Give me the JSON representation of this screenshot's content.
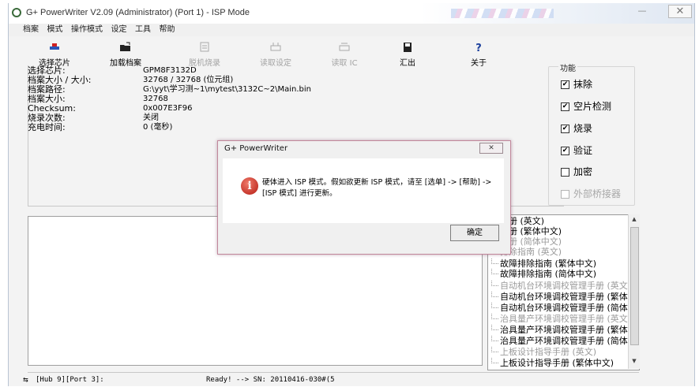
{
  "window": {
    "title": "G+ PowerWriter V2.09 (Administrator) (Port 1) - ISP Mode",
    "close_label": "✕",
    "minimize_label": "—"
  },
  "menubar": {
    "items": [
      "档案",
      "模式",
      "操作模式",
      "设定",
      "工具",
      "帮助"
    ]
  },
  "toolbar": {
    "buttons": [
      {
        "label": "选择芯片",
        "icon": "chip-select-icon",
        "enabled": true
      },
      {
        "label": "加载档案",
        "icon": "folder-open-icon",
        "enabled": true
      },
      {
        "label": "脱机烧录",
        "icon": "offline-burn-icon",
        "enabled": false
      },
      {
        "label": "读取设定",
        "icon": "read-settings-icon",
        "enabled": false
      },
      {
        "label": "读取 IC",
        "icon": "read-ic-icon",
        "enabled": false
      },
      {
        "label": "汇出",
        "icon": "save-icon",
        "enabled": true
      },
      {
        "label": "关于",
        "icon": "help-icon",
        "enabled": true
      }
    ]
  },
  "info": {
    "rows": [
      {
        "key": "选择芯片:",
        "value": "GPM8F3132D"
      },
      {
        "key": "档案大小 / 大小:",
        "value": "32768 / 32768 (位元组)"
      },
      {
        "key": "档案路径:",
        "value": "G:\\yyt\\学习测~1\\mytest\\3132C~2\\Main.bin"
      },
      {
        "key": "档案大小:",
        "value": "32768"
      },
      {
        "key": "Checksum:",
        "value": "0x007E3F96"
      },
      {
        "key": "烧录次数:",
        "value": "关闭"
      },
      {
        "key": "充电时间:",
        "value": "0 (毫秒)"
      }
    ]
  },
  "functions": {
    "legend": "功能",
    "items": [
      {
        "label": "抹除",
        "checked": true,
        "enabled": true
      },
      {
        "label": "空片检测",
        "checked": true,
        "enabled": true
      },
      {
        "label": "烧录",
        "checked": true,
        "enabled": true
      },
      {
        "label": "验证",
        "checked": true,
        "enabled": true
      },
      {
        "label": "加密",
        "checked": false,
        "enabled": true
      },
      {
        "label": "外部桥接器",
        "checked": false,
        "enabled": false
      }
    ]
  },
  "manuals": {
    "items": [
      {
        "label": "手册 (英文)",
        "gray": false
      },
      {
        "label": "手册 (繁体中文)",
        "gray": false
      },
      {
        "label": "手册 (简体中文)",
        "gray": true
      },
      {
        "label": "排除指南 (英文)",
        "gray": true
      },
      {
        "label": "故障排除指南 (繁体中文)",
        "gray": false
      },
      {
        "label": "故障排除指南 (简体中文)",
        "gray": false
      },
      {
        "label": "自动机台环境调校管理手册 (英文)",
        "gray": true
      },
      {
        "label": "自动机台环境调校管理手册 (繁体",
        "gray": false
      },
      {
        "label": "自动机台环境调校管理手册 (简体",
        "gray": false
      },
      {
        "label": "治具量产环境调校管理手册 (英文",
        "gray": true
      },
      {
        "label": "治具量产环境调校管理手册 (繁体",
        "gray": false
      },
      {
        "label": "治具量产环境调校管理手册 (简体",
        "gray": false
      },
      {
        "label": "上板设计指导手册 (英文)",
        "gray": true
      },
      {
        "label": "上板设计指导手册 (繁体中文)",
        "gray": false
      }
    ]
  },
  "statusbar": {
    "hub": "[Hub 9][Port 3]:",
    "ready": "Ready! --> SN: 20110416-030#(5"
  },
  "dialog": {
    "title": "G+ PowerWriter",
    "close_label": "✕",
    "message": "硬体进入 ISP 模式。假如欲更新 ISP 模式，请至 [选单] -> [帮助] -> [ISP 模式] 进行更新。",
    "ok_label": "确定"
  }
}
